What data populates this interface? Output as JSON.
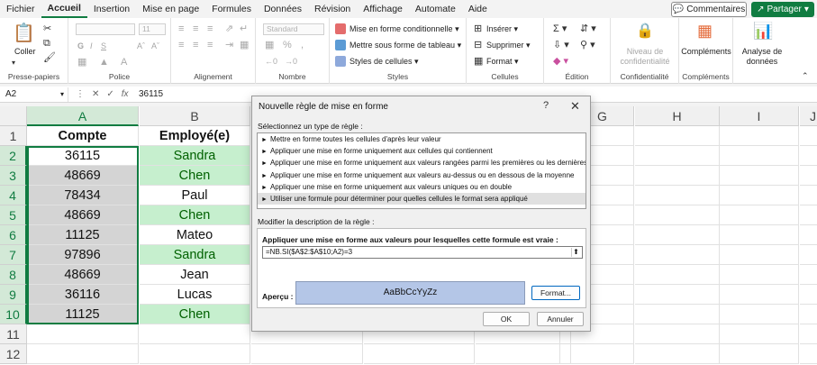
{
  "menubar": {
    "tabs": [
      "Fichier",
      "Accueil",
      "Insertion",
      "Mise en page",
      "Formules",
      "Données",
      "Révision",
      "Affichage",
      "Automate",
      "Aide"
    ],
    "active_index": 1,
    "comments_label": "Commentaires",
    "share_label": "Partager",
    "accent": "#107c41"
  },
  "ribbon": {
    "clipboard": {
      "paste_label": "Coller",
      "group_label": "Presse-papiers"
    },
    "font": {
      "font_name": "",
      "font_size": "11",
      "group_label": "Police"
    },
    "alignment": {
      "group_label": "Alignement"
    },
    "number": {
      "format_value": "Standard",
      "group_label": "Nombre"
    },
    "styles": {
      "conditional": "Mise en forme conditionnelle",
      "table": "Mettre sous forme de tableau",
      "cell_styles": "Styles de cellules",
      "group_label": "Styles"
    },
    "cells": {
      "insert": "Insérer",
      "delete": "Supprimer",
      "format": "Format",
      "group_label": "Cellules"
    },
    "editing": {
      "group_label": "Édition"
    },
    "sensitivity": {
      "label_line1": "Niveau de",
      "label_line2": "confidentialité",
      "group_label": "Confidentialité"
    },
    "addins": {
      "label": "Compléments",
      "group_label": "Compléments"
    },
    "analyze": {
      "label_line1": "Analyse de",
      "label_line2": "données"
    }
  },
  "formula_bar": {
    "name_box": "A2",
    "value": "36115"
  },
  "grid": {
    "columns": [
      "A",
      "B",
      "C",
      "D",
      "E",
      "F",
      "G",
      "H",
      "I",
      "J"
    ],
    "rows": [
      "1",
      "2",
      "3",
      "4",
      "5",
      "6",
      "7",
      "8",
      "9",
      "10",
      "11",
      "12"
    ],
    "header_a": "Compte",
    "header_b": "Employé(e)",
    "col_a": [
      "36115",
      "48669",
      "78434",
      "48669",
      "11125",
      "97896",
      "48669",
      "36116",
      "11125"
    ],
    "col_b": [
      "Sandra",
      "Chen",
      "Paul",
      "Chen",
      "Mateo",
      "Sandra",
      "Jean",
      "Lucas",
      "Chen"
    ],
    "col_b_highlight": [
      true,
      true,
      false,
      true,
      false,
      true,
      false,
      false,
      true
    ],
    "highlight_fill": "#c6efce",
    "highlight_text": "#006100"
  },
  "dialog": {
    "title": "Nouvelle règle de mise en forme",
    "help": "?",
    "select_type_label": "Sélectionnez un type de règle :",
    "rule_types": [
      "Mettre en forme toutes les cellules d'après leur valeur",
      "Appliquer une mise en forme uniquement aux cellules qui contiennent",
      "Appliquer une mise en forme uniquement aux valeurs rangées parmi les premières ou les dernières valeurs",
      "Appliquer une mise en forme uniquement aux valeurs au-dessus ou en dessous de la moyenne",
      "Appliquer une mise en forme uniquement aux valeurs uniques ou en double",
      "Utiliser une formule pour déterminer pour quelles cellules le format sera appliqué"
    ],
    "selected_rule_index": 5,
    "edit_desc_label": "Modifier la description de la règle :",
    "formula_prompt": "Appliquer une mise en forme aux valeurs pour lesquelles cette formule est vraie :",
    "formula_value": "=NB.SI($A$2:$A$10;A2)=3",
    "preview_label": "Aperçu :",
    "preview_text": "AaBbCcYyZz",
    "preview_fill": "#b4c6e7",
    "format_button": "Format...",
    "ok_button": "OK",
    "cancel_button": "Annuler"
  }
}
